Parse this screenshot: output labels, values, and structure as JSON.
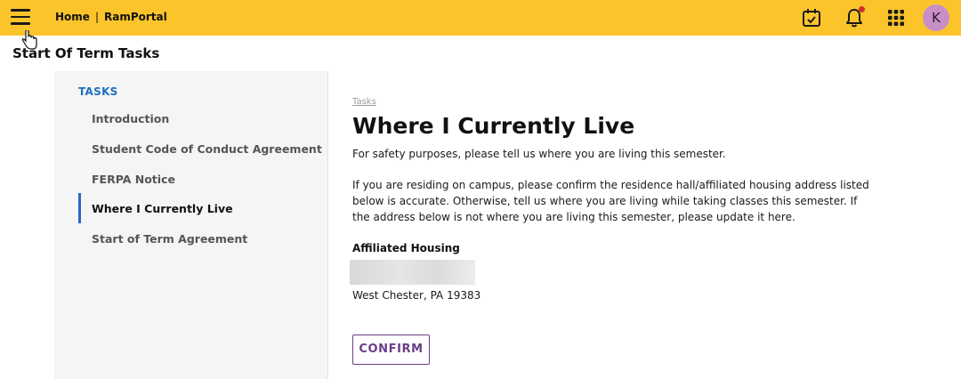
{
  "topbar": {
    "home_label": "Home",
    "separator": "|",
    "app_name": "RamPortal",
    "avatar_initial": "K",
    "accent_color": "#fcc42b",
    "notification_dot_color": "#d0302a",
    "avatar_color": "#c88ec6"
  },
  "page": {
    "title": "Start Of Term Tasks"
  },
  "sidebar": {
    "heading": "TASKS",
    "items": [
      {
        "label": "Introduction",
        "active": false
      },
      {
        "label": "Student Code of Conduct Agreement",
        "active": false
      },
      {
        "label": "FERPA Notice",
        "active": false
      },
      {
        "label": "Where I Currently Live",
        "active": true
      },
      {
        "label": "Start of Term Agreement",
        "active": false
      }
    ],
    "active_color": "#2b66c6",
    "heading_color": "#1f6fbf"
  },
  "main": {
    "breadcrumb": "Tasks",
    "title": "Where I Currently Live",
    "intro": "For safety purposes, please tell us where you are living this semester.",
    "instructions": "If you are residing on campus, please confirm the residence hall/affiliated housing address listed below is accurate. Otherwise, tell us where you are living while taking classes this semester. If the address below is not where you are living this semester, please update it here.",
    "housing_label": "Affiliated Housing",
    "address_city_line": "West Chester, PA 19383",
    "confirm_label": "CONFIRM",
    "button_color": "#6b3d86"
  },
  "icons": [
    "menu-icon",
    "pointer-cursor-icon",
    "calendar-check-icon",
    "bell-icon",
    "apps-grid-icon"
  ]
}
